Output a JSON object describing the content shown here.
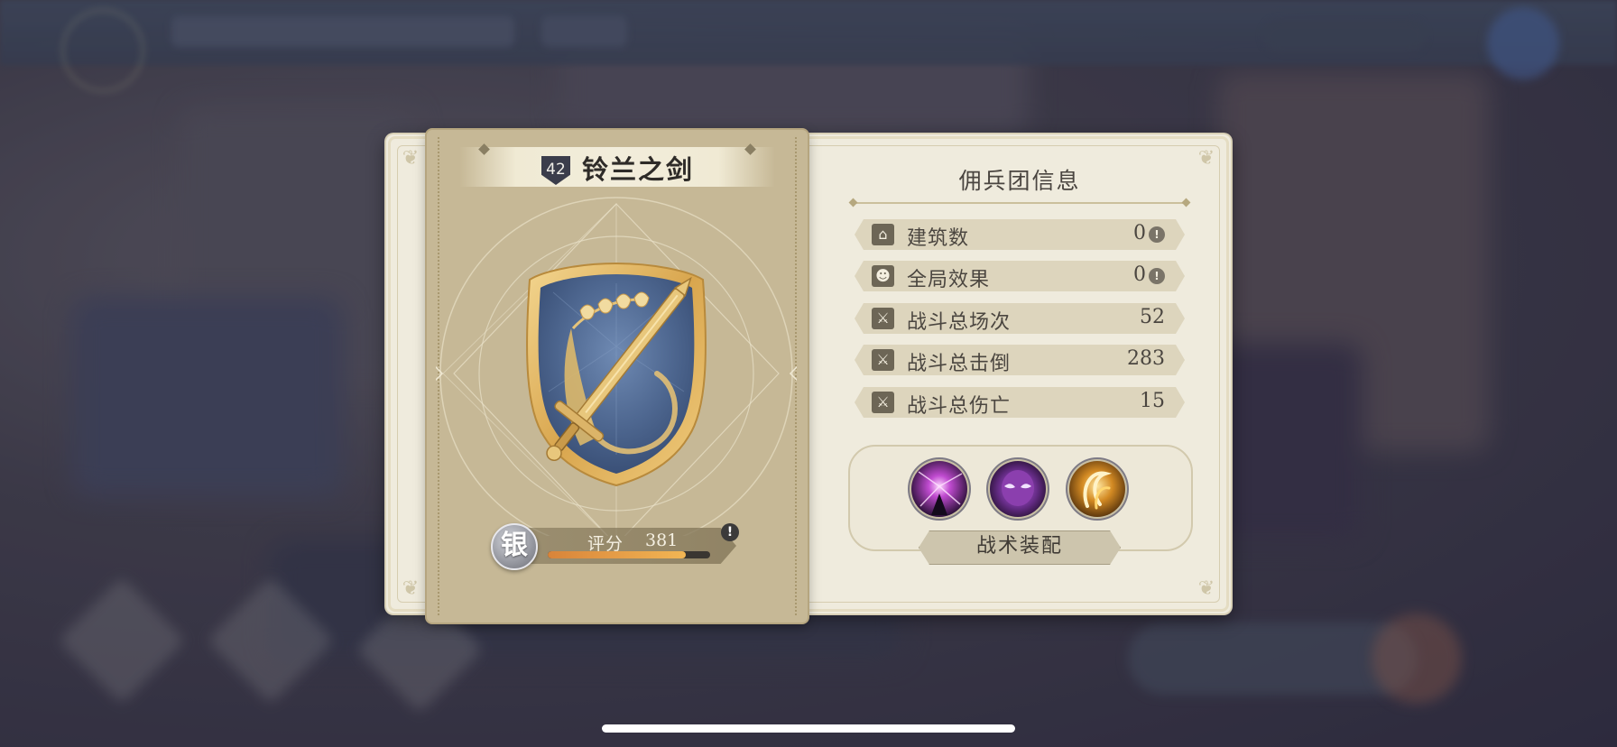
{
  "guild": {
    "level": "42",
    "name": "铃兰之剑",
    "rank_glyph": "银",
    "score_label": "评分",
    "score_value": "381",
    "score_progress": 0.85,
    "info_glyph": "!"
  },
  "info_panel": {
    "title": "佣兵团信息",
    "stats": [
      {
        "label": "建筑数",
        "value": "0",
        "icon": "house-icon",
        "has_info": true
      },
      {
        "label": "全局效果",
        "value": "0",
        "icon": "people-icon",
        "has_info": true
      },
      {
        "label": "战斗总场次",
        "value": "52",
        "icon": "crossed-swords-icon",
        "has_info": false
      },
      {
        "label": "战斗总击倒",
        "value": "283",
        "icon": "crossed-swords-icon",
        "has_info": false
      },
      {
        "label": "战斗总伤亡",
        "value": "15",
        "icon": "crossed-swords-icon",
        "has_info": false
      }
    ]
  },
  "tactics": {
    "button_label": "战术装配",
    "skills": [
      "purple-burst-skill-icon",
      "purple-mask-skill-icon",
      "golden-swirl-skill-icon"
    ]
  },
  "colors": {
    "panel_bg": "#efebdd",
    "card_bg": "#c6b896",
    "emblem_blue": "#4e6790",
    "emblem_gold": "#e0b868",
    "score_fill": "#f2b654"
  }
}
